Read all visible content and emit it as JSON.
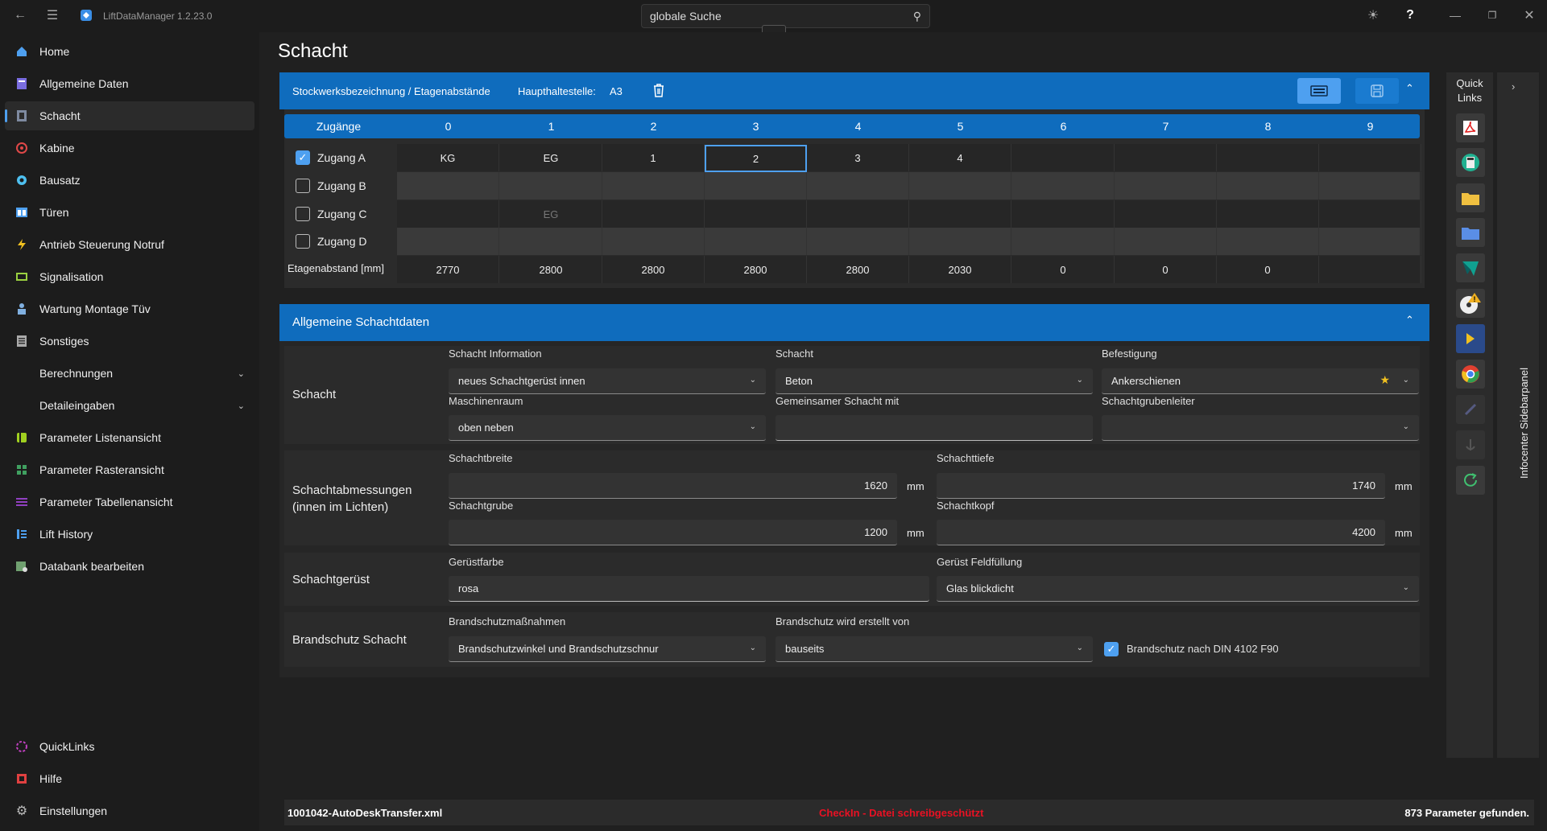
{
  "app": {
    "title": "LiftDataManager 1.2.23.0",
    "search_placeholder": "globale Suche",
    "help": "?"
  },
  "sidebar": {
    "items": [
      {
        "label": "Home",
        "color": "#4ea0f0"
      },
      {
        "label": "Allgemeine Daten",
        "color": "#7a6de0"
      },
      {
        "label": "Schacht",
        "color": "#7e8aa0"
      },
      {
        "label": "Kabine",
        "color": "#e04848"
      },
      {
        "label": "Bausatz",
        "color": "#4ec0f0"
      },
      {
        "label": "Türen",
        "color": "#4ea0f0"
      },
      {
        "label": "Antrieb Steuerung Notruf",
        "color": "#f0c020"
      },
      {
        "label": "Signalisation",
        "color": "#9ad040"
      },
      {
        "label": "Wartung Montage Tüv",
        "color": "#80b0e0"
      },
      {
        "label": "Sonstiges",
        "color": "#aaaaaa"
      },
      {
        "label": "Berechnungen",
        "color": ""
      },
      {
        "label": "Detaileingaben",
        "color": ""
      },
      {
        "label": "Parameter Listenansicht",
        "color": "#a0d020"
      },
      {
        "label": "Parameter Rasteransicht",
        "color": "#40a060"
      },
      {
        "label": "Parameter Tabellenansicht",
        "color": "#9040c0"
      },
      {
        "label": "Lift History",
        "color": "#4ea0f0"
      },
      {
        "label": "Databank bearbeiten",
        "color": "#70a070"
      }
    ],
    "bottom": [
      {
        "label": "QuickLinks",
        "color": "#c040c0"
      },
      {
        "label": "Hilfe",
        "color": "#e04040"
      },
      {
        "label": "Einstellungen",
        "color": "#bbbbbb"
      }
    ]
  },
  "page": {
    "title": "Schacht"
  },
  "floors": {
    "header_title": "Stockwerksbezeichnung / Etagenabstände",
    "haupthalt_label": "Haupthaltestelle:",
    "haupthalt_value": "A3",
    "col_header": "Zugänge",
    "columns": [
      "0",
      "1",
      "2",
      "3",
      "4",
      "5",
      "6",
      "7",
      "8",
      "9"
    ],
    "rows": [
      {
        "label": "Zugang A",
        "checked": true,
        "cells": [
          "KG",
          "EG",
          "1",
          "2",
          "3",
          "4",
          "",
          "",
          "",
          ""
        ]
      },
      {
        "label": "Zugang B",
        "checked": false,
        "cells": [
          "",
          "",
          "",
          "",
          "",
          "",
          "",
          "",
          "",
          ""
        ]
      },
      {
        "label": "Zugang C",
        "checked": false,
        "cells": [
          "",
          "EG",
          "",
          "",
          "",
          "",
          "",
          "",
          "",
          ""
        ]
      },
      {
        "label": "Zugang D",
        "checked": false,
        "cells": [
          "",
          "",
          "",
          "",
          "",
          "",
          "",
          "",
          "",
          ""
        ]
      }
    ],
    "distance_label": "Etagenabstand [mm]",
    "distances": [
      "2770",
      "2800",
      "2800",
      "2800",
      "2800",
      "2030",
      "0",
      "0",
      "0",
      ""
    ]
  },
  "shaft": {
    "section_title": "Allgemeine Schachtdaten",
    "group1": {
      "title": "Schacht",
      "schacht_info_label": "Schacht Information",
      "schacht_info_value": "neues Schachtgerüst innen",
      "schacht_label": "Schacht",
      "schacht_value": "Beton",
      "befestigung_label": "Befestigung",
      "befestigung_value": "Ankerschienen",
      "maschinenraum_label": "Maschinenraum",
      "maschinenraum_value": "oben neben",
      "gemeinsam_label": "Gemeinsamer Schacht mit",
      "gemeinsam_value": "",
      "leiter_label": "Schachtgrubenleiter",
      "leiter_value": ""
    },
    "group2": {
      "title": "Schachtabmessungen (innen im Lichten)",
      "breite_label": "Schachtbreite",
      "breite_value": "1620",
      "tiefe_label": "Schachttiefe",
      "tiefe_value": "1740",
      "grube_label": "Schachtgrube",
      "grube_value": "1200",
      "kopf_label": "Schachtkopf",
      "kopf_value": "4200",
      "unit": "mm"
    },
    "group3": {
      "title": "Schachtgerüst",
      "farbe_label": "Gerüstfarbe",
      "farbe_value": "rosa",
      "feld_label": "Gerüst Feldfüllung",
      "feld_value": "Glas blickdicht"
    },
    "group4": {
      "title": "Brandschutz Schacht",
      "massnahmen_label": "Brandschutzmaßnahmen",
      "massnahmen_value": "Brandschutzwinkel und Brandschutzschnur",
      "erstellt_label": "Brandschutz wird erstellt von",
      "erstellt_value": "bauseits",
      "din_label": "Brandschutz nach DIN 4102 F90",
      "din_checked": true
    }
  },
  "quicklinks": {
    "title": "Quick Links"
  },
  "infopanel": {
    "title": "Infocenter Sidebarpanel"
  },
  "status": {
    "file": "1001042-AutoDeskTransfer.xml",
    "message": "CheckIn - Datei schreibgeschützt",
    "params": "873 Parameter gefunden."
  },
  "colors": {
    "accent": "#0f6cbd",
    "error": "#e81123"
  }
}
